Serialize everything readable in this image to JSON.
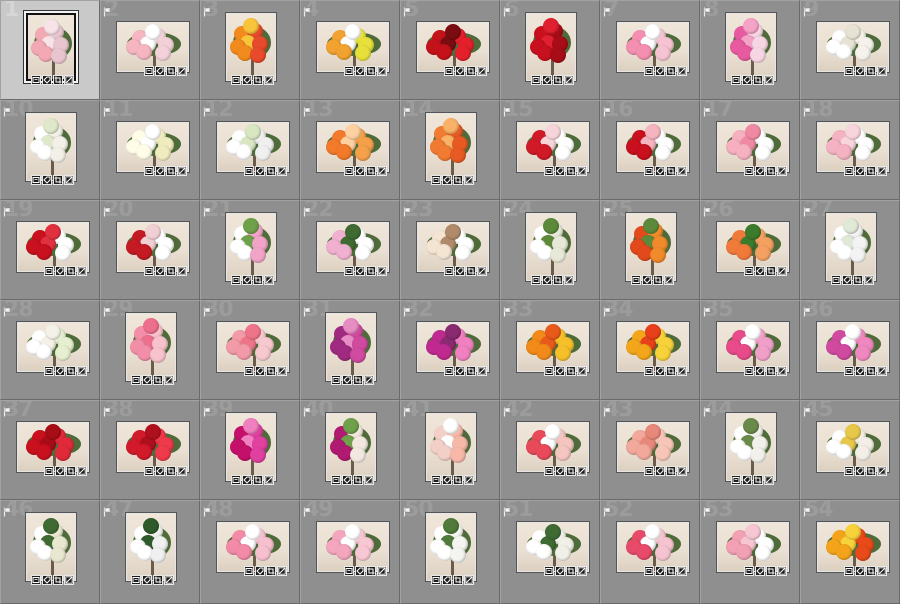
{
  "colors": {
    "grid_bg": "#8f8f8f",
    "selected_bg": "#c9c9c9",
    "wall": "#e9dfd2",
    "foliage": "#4f6b3a"
  },
  "badge_icons": [
    "metadata-icon",
    "keyword-tag-icon",
    "crop-icon",
    "develop-settings-icon"
  ],
  "cells": [
    {
      "index": "1",
      "selected": true,
      "orient": "portrait",
      "palette": [
        "#f2a9b4",
        "#e9c6cf",
        "#f7e3e8"
      ]
    },
    {
      "index": "2",
      "orient": "landscape",
      "palette": [
        "#f5b6c1",
        "#f2d2d8",
        "#ffffff"
      ]
    },
    {
      "index": "3",
      "orient": "portrait",
      "palette": [
        "#f28a1e",
        "#e84a2c",
        "#f7c43a"
      ]
    },
    {
      "index": "4",
      "orient": "landscape",
      "palette": [
        "#f2a230",
        "#e8e03a",
        "#ffffff"
      ]
    },
    {
      "index": "5",
      "orient": "landscape",
      "palette": [
        "#c4121b",
        "#e4202a",
        "#7a0d12"
      ]
    },
    {
      "index": "6",
      "orient": "portrait",
      "palette": [
        "#c8101e",
        "#a80d17",
        "#e02030"
      ]
    },
    {
      "index": "7",
      "orient": "landscape",
      "palette": [
        "#f48fb1",
        "#f6c3d3",
        "#ffffff"
      ]
    },
    {
      "index": "8",
      "orient": "portrait",
      "palette": [
        "#e85aa0",
        "#f7d6e3",
        "#f4a2c6"
      ]
    },
    {
      "index": "9",
      "orient": "landscape",
      "palette": [
        "#ffffff",
        "#f4f2ea",
        "#e6e2d4"
      ]
    },
    {
      "index": "10",
      "orient": "portrait",
      "palette": [
        "#ffffff",
        "#f2f0e8",
        "#dfe9c9"
      ]
    },
    {
      "index": "11",
      "orient": "landscape",
      "palette": [
        "#fffde8",
        "#f1ecbf",
        "#ffffff"
      ]
    },
    {
      "index": "12",
      "orient": "landscape",
      "palette": [
        "#ffffff",
        "#f0f0f0",
        "#d8e6c2"
      ]
    },
    {
      "index": "13",
      "orient": "landscape",
      "palette": [
        "#f27a2a",
        "#f5a04a",
        "#ffd0a0"
      ]
    },
    {
      "index": "14",
      "orient": "portrait",
      "palette": [
        "#f27b32",
        "#e85a24",
        "#f9b267"
      ]
    },
    {
      "index": "15",
      "orient": "landscape",
      "palette": [
        "#d11a28",
        "#ffffff",
        "#f5d5d9"
      ]
    },
    {
      "index": "16",
      "orient": "landscape",
      "palette": [
        "#c8101e",
        "#ffffff",
        "#f5b4bf"
      ]
    },
    {
      "index": "17",
      "orient": "landscape",
      "palette": [
        "#f6b0c0",
        "#ffffff",
        "#f08aa4"
      ]
    },
    {
      "index": "18",
      "orient": "landscape",
      "palette": [
        "#f5b2c2",
        "#ffffff",
        "#f8d4dd"
      ]
    },
    {
      "index": "19",
      "orient": "landscape",
      "palette": [
        "#c8101e",
        "#ffffff",
        "#e23040"
      ]
    },
    {
      "index": "20",
      "orient": "landscape",
      "palette": [
        "#c41a24",
        "#ffffff",
        "#f1d0d4"
      ]
    },
    {
      "index": "21",
      "orient": "portrait",
      "palette": [
        "#ffffff",
        "#f2a4c8",
        "#6fa04a"
      ]
    },
    {
      "index": "22",
      "orient": "landscape",
      "palette": [
        "#f2b0d0",
        "#ffffff",
        "#3f6b33"
      ]
    },
    {
      "index": "23",
      "orient": "landscape",
      "palette": [
        "#f4e4d2",
        "#ffffff",
        "#b08a6a"
      ]
    },
    {
      "index": "24",
      "orient": "portrait",
      "palette": [
        "#ffffff",
        "#e8e8d8",
        "#5d8a3a"
      ]
    },
    {
      "index": "25",
      "orient": "portrait",
      "palette": [
        "#e24a1c",
        "#f08a2a",
        "#5d8a3a"
      ]
    },
    {
      "index": "26",
      "orient": "landscape",
      "palette": [
        "#f07a3a",
        "#f4a060",
        "#3c7a2c"
      ]
    },
    {
      "index": "27",
      "orient": "portrait",
      "palette": [
        "#ffffff",
        "#f3f3f3",
        "#e0e8d8"
      ]
    },
    {
      "index": "28",
      "orient": "landscape",
      "palette": [
        "#ffffff",
        "#e6efd0",
        "#f4f1e6"
      ]
    },
    {
      "index": "29",
      "orient": "portrait",
      "palette": [
        "#f28ea8",
        "#f7c2cc",
        "#ee6f8d"
      ]
    },
    {
      "index": "30",
      "orient": "landscape",
      "palette": [
        "#f29aa8",
        "#f7c9cf",
        "#ee7589"
      ]
    },
    {
      "index": "31",
      "orient": "portrait",
      "palette": [
        "#a02a80",
        "#d04aa0",
        "#e88cc4"
      ]
    },
    {
      "index": "32",
      "orient": "landscape",
      "palette": [
        "#c02a90",
        "#f080c0",
        "#8a2a70"
      ]
    },
    {
      "index": "33",
      "orient": "landscape",
      "palette": [
        "#f28a1a",
        "#f6c02a",
        "#e85a1a"
      ]
    },
    {
      "index": "34",
      "orient": "landscape",
      "palette": [
        "#f4a61a",
        "#f7d23a",
        "#e8401a"
      ]
    },
    {
      "index": "35",
      "orient": "landscape",
      "palette": [
        "#e84a8a",
        "#f0a0c8",
        "#ffffff"
      ]
    },
    {
      "index": "36",
      "orient": "landscape",
      "palette": [
        "#d04aa0",
        "#f088c0",
        "#ffffff"
      ]
    },
    {
      "index": "37",
      "orient": "landscape",
      "palette": [
        "#c8101e",
        "#e02a3a",
        "#a80d17"
      ]
    },
    {
      "index": "38",
      "orient": "landscape",
      "palette": [
        "#d21a2a",
        "#ee3a4a",
        "#b0101e"
      ]
    },
    {
      "index": "39",
      "orient": "portrait",
      "palette": [
        "#c4106a",
        "#e040a0",
        "#f080c0"
      ]
    },
    {
      "index": "40",
      "orient": "portrait",
      "palette": [
        "#b01a70",
        "#f2e8e0",
        "#6fa04a"
      ]
    },
    {
      "index": "41",
      "orient": "portrait",
      "palette": [
        "#f2d0c8",
        "#f7b8a8",
        "#ffffff"
      ]
    },
    {
      "index": "42",
      "orient": "landscape",
      "palette": [
        "#e84a5a",
        "#f5c5c0",
        "#ffffff"
      ]
    },
    {
      "index": "43",
      "orient": "landscape",
      "palette": [
        "#f2a89a",
        "#f7c6b8",
        "#e8887a"
      ]
    },
    {
      "index": "44",
      "orient": "portrait",
      "palette": [
        "#ffffff",
        "#f2f0ea",
        "#6a8a4a"
      ]
    },
    {
      "index": "45",
      "orient": "landscape",
      "palette": [
        "#ffffff",
        "#f3efe6",
        "#e8c84a"
      ]
    },
    {
      "index": "46",
      "orient": "portrait",
      "palette": [
        "#ffffff",
        "#e8e8d0",
        "#3f6b33"
      ]
    },
    {
      "index": "47",
      "orient": "portrait",
      "palette": [
        "#ffffff",
        "#f0f0f0",
        "#2f5a2a"
      ]
    },
    {
      "index": "48",
      "orient": "landscape",
      "palette": [
        "#f28aa8",
        "#f6c0cf",
        "#ffffff"
      ]
    },
    {
      "index": "49",
      "orient": "landscape",
      "palette": [
        "#f4a6bf",
        "#f8c7d4",
        "#ffffff"
      ]
    },
    {
      "index": "50",
      "orient": "portrait",
      "palette": [
        "#ffffff",
        "#f4f4f0",
        "#4f7a3a"
      ]
    },
    {
      "index": "51",
      "orient": "landscape",
      "palette": [
        "#ffffff",
        "#f0f0e8",
        "#3f6b33"
      ]
    },
    {
      "index": "52",
      "orient": "landscape",
      "palette": [
        "#e84a6a",
        "#f6c4d0",
        "#ffffff"
      ]
    },
    {
      "index": "53",
      "orient": "landscape",
      "palette": [
        "#f2a0b4",
        "#ffffff",
        "#f6c6d2"
      ]
    },
    {
      "index": "54",
      "orient": "landscape",
      "palette": [
        "#f4a41a",
        "#e84a1a",
        "#f7d23a"
      ]
    }
  ]
}
